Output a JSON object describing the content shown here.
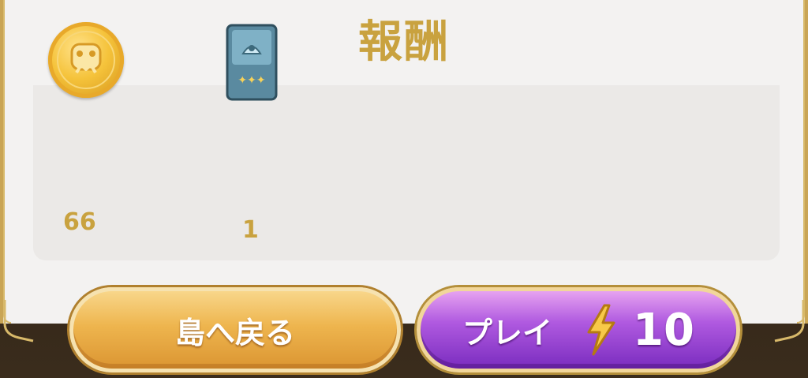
{
  "title": "報酬",
  "rewards": [
    {
      "icon": "gold-coin-icon",
      "count": "66"
    },
    {
      "icon": "card-pack-icon",
      "count": "1"
    }
  ],
  "buttons": {
    "back_label": "島へ戻る",
    "play_label": "プレイ",
    "play_cost": "10",
    "play_cost_icon": "lightning-bolt-icon"
  },
  "colors": {
    "gold_text": "#c9a23f",
    "back_button": "#eeb54e",
    "play_button": "#9b44d6"
  }
}
